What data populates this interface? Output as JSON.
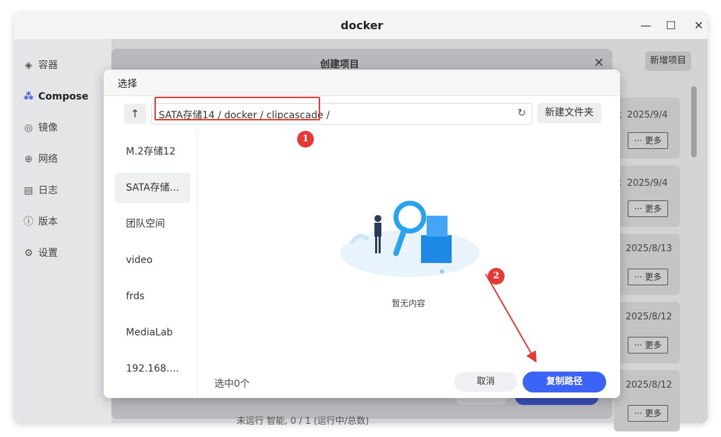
{
  "window": {
    "title": "docker"
  },
  "sidebar": {
    "items": [
      {
        "label": "容器",
        "icon": "layers-icon"
      },
      {
        "label": "Compose",
        "icon": "compose-icon"
      },
      {
        "label": "镜像",
        "icon": "image-icon"
      },
      {
        "label": "网络",
        "icon": "globe-icon"
      },
      {
        "label": "日志",
        "icon": "log-icon"
      },
      {
        "label": "版本",
        "icon": "info-icon"
      },
      {
        "label": "设置",
        "icon": "gear-icon"
      }
    ]
  },
  "background": {
    "new_project_label": "新增项目",
    "dialog_title": "创建项目",
    "cards": [
      {
        "date": "：2025/9/4",
        "more": "··· 更多"
      },
      {
        "date": "：2025/9/4",
        "more": "··· 更多"
      },
      {
        "date": "2025/8/13",
        "more": "··· 更多"
      },
      {
        "date": "2025/8/12",
        "more": "··· 更多"
      },
      {
        "date": "2025/8/12",
        "more": "··· 更多"
      }
    ],
    "footer_text": "未运行     智能, 0 / 1 (运行中/总数)"
  },
  "dialog": {
    "title": "选择",
    "path": "SATA存储14 / docker / clipcascade /",
    "new_folder_label": "新建文件夹",
    "locations": [
      "M.2存储12",
      "SATA存储…",
      "团队空间",
      "video",
      "frds",
      "MediaLab",
      "192.168.…"
    ],
    "empty_label": "暂无内容",
    "selected_count": "选中0个",
    "cancel_label": "取消",
    "copy_path_label": "复制路径"
  },
  "annotations": {
    "badge1": "1",
    "badge2": "2"
  },
  "colors": {
    "accent": "#3b63f5",
    "annotation": "#e53935"
  }
}
